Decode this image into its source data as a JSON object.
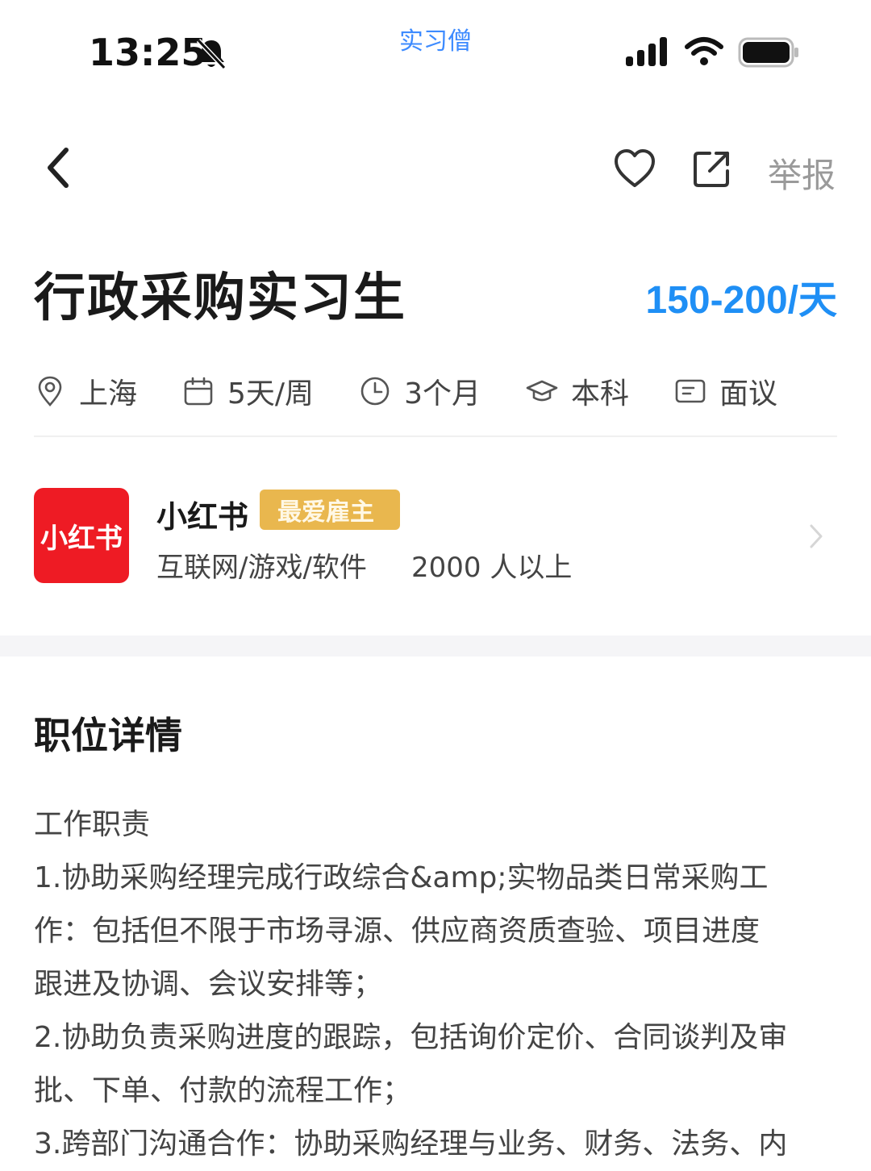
{
  "status": {
    "time": "13:25",
    "watermark": "实习僧"
  },
  "nav": {
    "report": "举报"
  },
  "job": {
    "title": "行政采购实习生",
    "salary": "150-200/天",
    "meta": [
      "上海",
      "5天/周",
      "3个月",
      "本科",
      "面议"
    ]
  },
  "company": {
    "logo_text": "小红书",
    "name": "小红书",
    "badge": "最爱雇主",
    "industry": "互联网/游戏/软件",
    "size": "2000 人以上"
  },
  "details": {
    "section_title": "职位详情",
    "lines": [
      "工作职责",
      "1.协助采购经理完成行政综合&amp;实物品类日常采购工",
      "作：包括但不限于市场寻源、供应商资质查验、项目进度",
      "跟进及协调、会议安排等；",
      "2.协助负责采购进度的跟踪，包括询价定价、合同谈判及审",
      "批、下单、付款的流程工作；",
      "3.跨部门沟通合作：协助采购经理与业务、财务、法务、内"
    ]
  },
  "colors": {
    "accent": "#1f8ff5",
    "logo_red": "#ee1b24",
    "badge_gold": "#e9b74e"
  }
}
